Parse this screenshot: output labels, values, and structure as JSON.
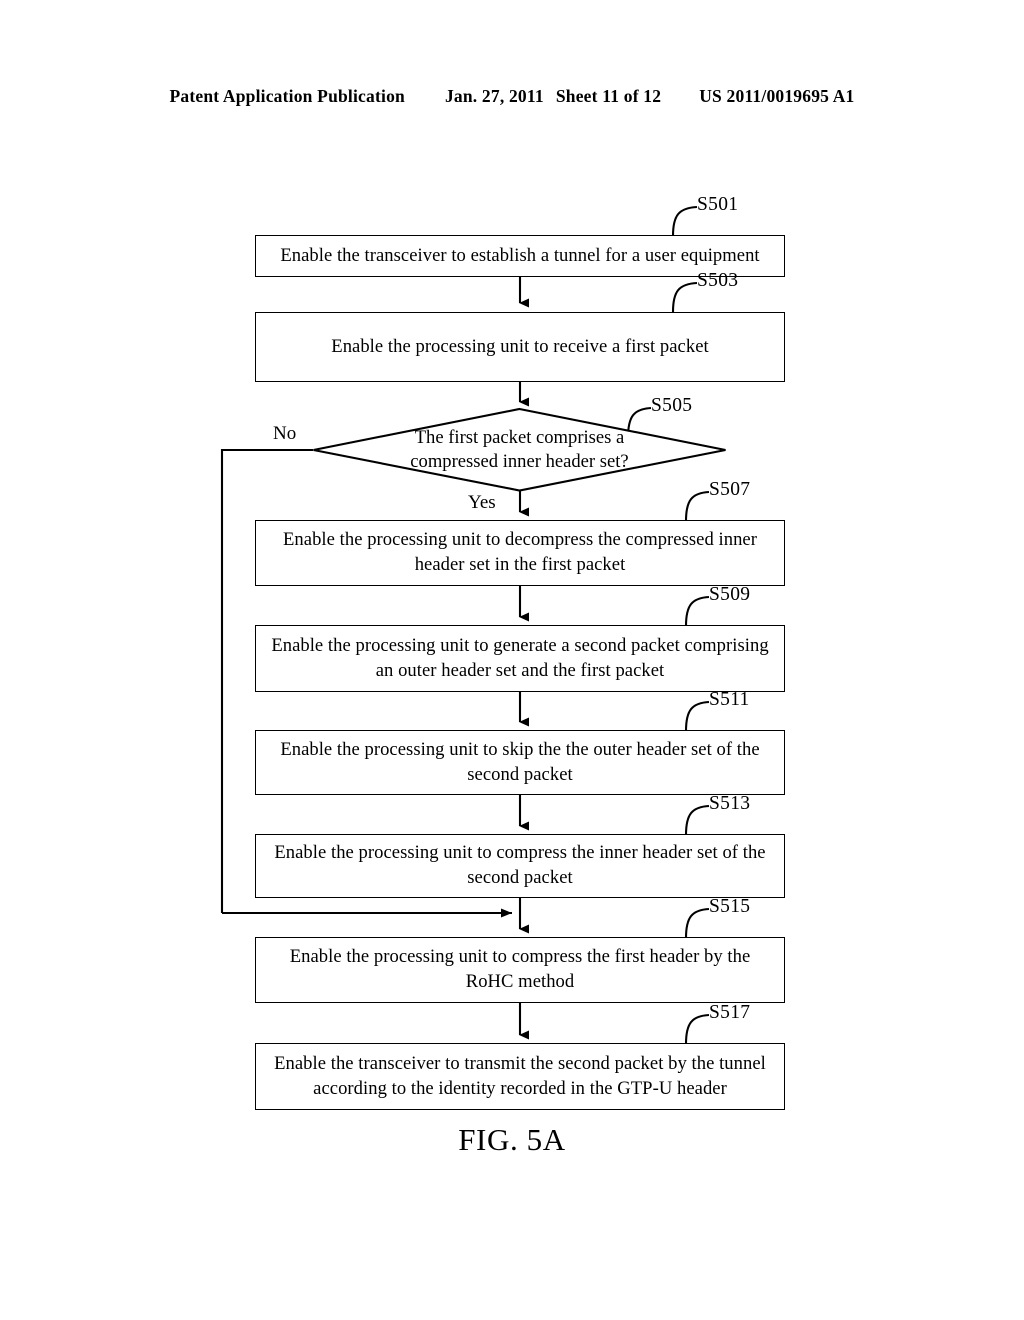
{
  "page": {
    "header": {
      "publication": "Patent Application Publication",
      "date": "Jan. 27, 2011",
      "sheet": "Sheet 11 of 12",
      "doc_number": "US 2011/0019695 A1"
    },
    "figure_caption": "FIG. 5A",
    "background_color": "#ffffff",
    "ink_color": "#000000"
  },
  "flowchart": {
    "nodes": [
      {
        "ref": "S501",
        "type": "process",
        "text": "Enable the transceiver to establish a tunnel for a user equipment"
      },
      {
        "ref": "S503",
        "type": "process",
        "text": "Enable the processing unit to receive a first packet"
      },
      {
        "ref": "S505",
        "type": "decision",
        "text_line1": "The first packet comprises a",
        "text_line2": "compressed inner header set?",
        "yes_label": "Yes",
        "no_label": "No"
      },
      {
        "ref": "S507",
        "type": "process",
        "text": "Enable the processing unit to decompress the compressed inner header set in the first packet"
      },
      {
        "ref": "S509",
        "type": "process",
        "text": "Enable the processing unit to generate a second packet comprising an outer header set and the first packet"
      },
      {
        "ref": "S511",
        "type": "process",
        "text": "Enable the processing unit to skip the the outer header set of the second packet"
      },
      {
        "ref": "S513",
        "type": "process",
        "text": "Enable the processing unit to compress the inner header set of the second packet"
      },
      {
        "ref": "S515",
        "type": "process",
        "text": "Enable the processing unit to compress the first header by the RoHC method"
      },
      {
        "ref": "S517",
        "type": "process",
        "text": "Enable the transceiver to transmit the second packet by the tunnel according to the identity recorded in the GTP-U header"
      }
    ]
  }
}
